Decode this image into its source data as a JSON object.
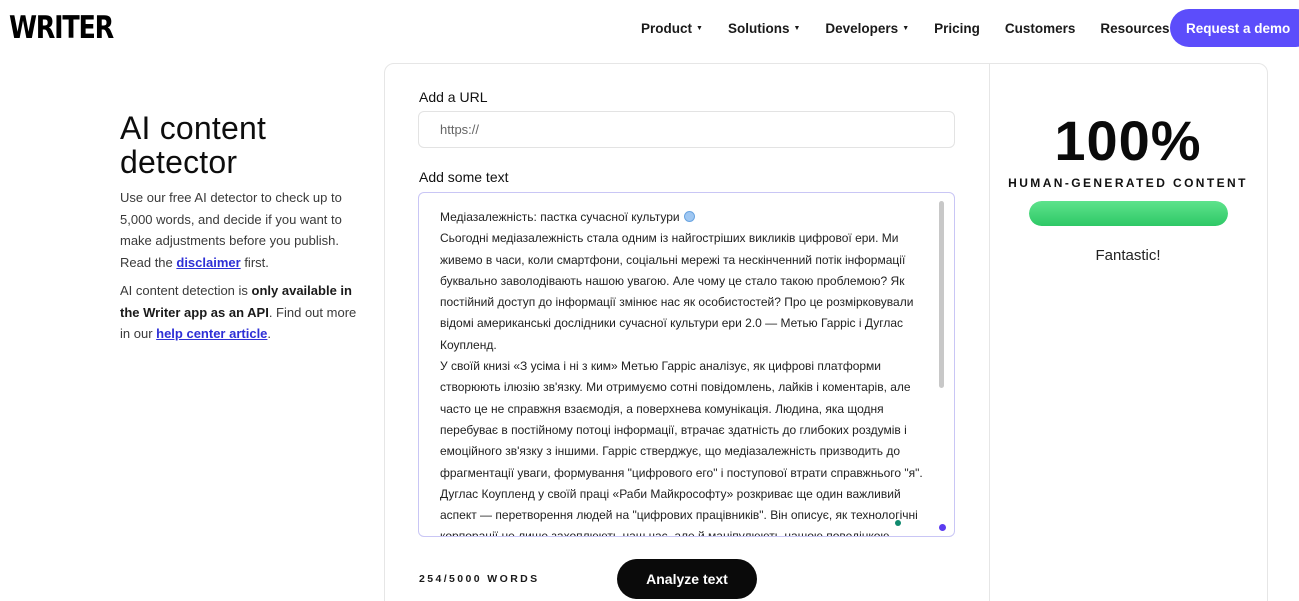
{
  "brand": {
    "logo_text": "WRITER"
  },
  "nav": {
    "items": [
      {
        "label": "Product",
        "dropdown": true
      },
      {
        "label": "Solutions",
        "dropdown": true
      },
      {
        "label": "Developers",
        "dropdown": true
      },
      {
        "label": "Pricing",
        "dropdown": false
      },
      {
        "label": "Customers",
        "dropdown": false
      },
      {
        "label": "Resources",
        "dropdown": true
      }
    ],
    "cta_label": "Request a demo"
  },
  "intro": {
    "title": "AI content detector",
    "p1_before": "Use our free AI detector to check up to 5,000 words, and decide if you want to make adjustments before you publish. Read the ",
    "p1_link": "disclaimer",
    "p1_after": " first.",
    "p2_before": "AI content detection is ",
    "p2_bold": "only available in the Writer app as an API",
    "p2_middle": ". Find out more in our ",
    "p2_link": "help center article",
    "p2_after": "."
  },
  "form": {
    "url_label": "Add a URL",
    "url_placeholder": "https://",
    "url_value": "",
    "text_label": "Add some text",
    "text_title": "Медіазалежність: пастка сучасної культури",
    "text_paragraphs": [
      "Сьогодні медіазалежність стала одним із найгостріших викликів цифрової ери. Ми живемо в часи, коли смартфони, соціальні мережі та нескінченний потік інформації буквально заволодівають нашою увагою. Але чому це стало такою проблемою? Як постійний доступ до інформації змінює нас як особистостей? Про це розмірковували відомі американські дослідники сучасної культури ери 2.0 — Метью Гарріс і Дуглас Коупленд.",
      "У своїй книзі «З усіма і ні з ким» Метью Гарріс аналізує, як цифрові платформи створюють ілюзію зв'язку. Ми отримуємо сотні повідомлень, лайків і коментарів, але часто це не справжня взаємодія, а поверхнева комунікація. Людина, яка щодня перебуває в постійному потоці інформації, втрачає здатність до глибоких роздумів і емоційного зв'язку з іншими. Гарріс стверджує, що медіазалежність призводить до фрагментації уваги, формування \"цифрового его\" і поступової втрати справжнього \"я\".",
      "Дуглас Коупленд у своїй праці «Раби Майкрософту» розкриває ще один важливий аспект — перетворення людей на \"цифрових працівників\". Він описує, як технологічні корпорації не лише захоплюють наш час, але й маніпулюють нашою поведінкою"
    ],
    "word_count": "254/5000 WORDS",
    "analyze_label": "Analyze text"
  },
  "result": {
    "score": "100%",
    "score_label": "HUMAN-GENERATED CONTENT",
    "human_fraction": 1.0,
    "verdict": "Fantastic!",
    "bar_color": "#2ec866"
  },
  "colors": {
    "accent": "#5c4dfb",
    "link": "#2e2fd6",
    "button_dark": "#0a0a0a"
  }
}
